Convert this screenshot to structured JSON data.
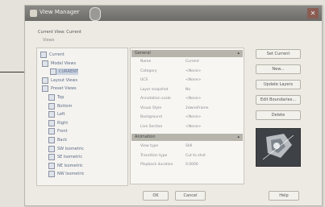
{
  "dialog": {
    "title": "View Manager",
    "current_view_label": "Current View: Current",
    "views_label": "Views"
  },
  "tree": [
    {
      "label": "Current",
      "sel": false
    },
    {
      "label": "Model Views",
      "sel": false
    },
    {
      "label": "CURRENT",
      "sel": true
    },
    {
      "label": "Layout Views",
      "sel": false
    },
    {
      "label": "Preset Views",
      "sel": false
    },
    {
      "label": "Top",
      "sel": false
    },
    {
      "label": "Bottom",
      "sel": false
    },
    {
      "label": "Left",
      "sel": false
    },
    {
      "label": "Right",
      "sel": false
    },
    {
      "label": "Front",
      "sel": false
    },
    {
      "label": "Back",
      "sel": false
    },
    {
      "label": "SW Isometric",
      "sel": false
    },
    {
      "label": "SE Isometric",
      "sel": false
    },
    {
      "label": "NE Isometric",
      "sel": false
    },
    {
      "label": "NW Isometric",
      "sel": false
    }
  ],
  "properties": {
    "general_title": "General",
    "general_rows": [
      {
        "k": "Name",
        "v": "Current"
      },
      {
        "k": "Category",
        "v": "<None>"
      },
      {
        "k": "UCS",
        "v": "<None>"
      },
      {
        "k": "Layer snapshot",
        "v": "No"
      },
      {
        "k": "Annotation scale",
        "v": "<None>"
      },
      {
        "k": "Visual Style",
        "v": "2dwireframe"
      },
      {
        "k": "Background",
        "v": "<None>"
      },
      {
        "k": "Live Section",
        "v": "<None>"
      }
    ],
    "animation_title": "Animation",
    "animation_rows": [
      {
        "k": "View type",
        "v": "Still"
      },
      {
        "k": "Transition type",
        "v": "Cut to shot"
      },
      {
        "k": "Playback duration",
        "v": "0.0000"
      }
    ]
  },
  "buttons": {
    "set_current": "Set Current",
    "new": "New...",
    "update_layers": "Update Layers",
    "edit_boundaries": "Edit Boundaries...",
    "delete": "Delete",
    "ok": "OK",
    "cancel": "Cancel",
    "help": "Help"
  },
  "icons": {
    "title": "view-manager-icon",
    "cursor": "mouse-cursor-icon",
    "close": "close-icon"
  }
}
